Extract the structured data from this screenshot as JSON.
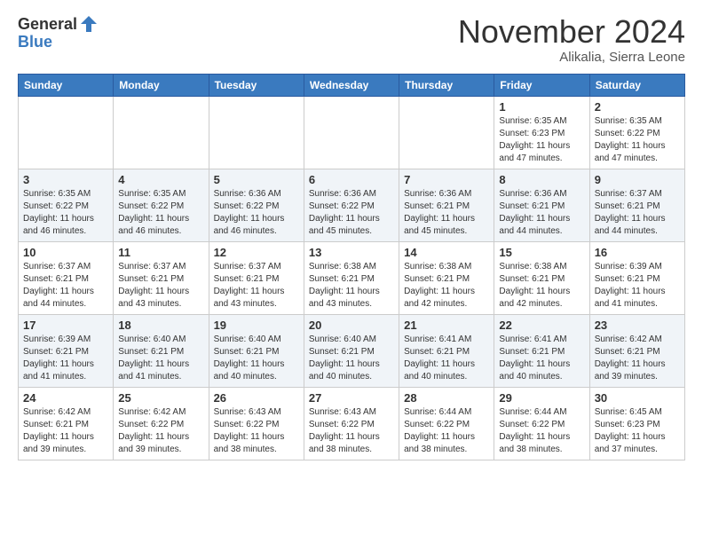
{
  "header": {
    "logo_general": "General",
    "logo_blue": "Blue",
    "month_title": "November 2024",
    "location": "Alikalia, Sierra Leone"
  },
  "weekdays": [
    "Sunday",
    "Monday",
    "Tuesday",
    "Wednesday",
    "Thursday",
    "Friday",
    "Saturday"
  ],
  "weeks": [
    [
      {
        "day": "",
        "info": ""
      },
      {
        "day": "",
        "info": ""
      },
      {
        "day": "",
        "info": ""
      },
      {
        "day": "",
        "info": ""
      },
      {
        "day": "",
        "info": ""
      },
      {
        "day": "1",
        "info": "Sunrise: 6:35 AM\nSunset: 6:23 PM\nDaylight: 11 hours and 47 minutes."
      },
      {
        "day": "2",
        "info": "Sunrise: 6:35 AM\nSunset: 6:22 PM\nDaylight: 11 hours and 47 minutes."
      }
    ],
    [
      {
        "day": "3",
        "info": "Sunrise: 6:35 AM\nSunset: 6:22 PM\nDaylight: 11 hours and 46 minutes."
      },
      {
        "day": "4",
        "info": "Sunrise: 6:35 AM\nSunset: 6:22 PM\nDaylight: 11 hours and 46 minutes."
      },
      {
        "day": "5",
        "info": "Sunrise: 6:36 AM\nSunset: 6:22 PM\nDaylight: 11 hours and 46 minutes."
      },
      {
        "day": "6",
        "info": "Sunrise: 6:36 AM\nSunset: 6:22 PM\nDaylight: 11 hours and 45 minutes."
      },
      {
        "day": "7",
        "info": "Sunrise: 6:36 AM\nSunset: 6:21 PM\nDaylight: 11 hours and 45 minutes."
      },
      {
        "day": "8",
        "info": "Sunrise: 6:36 AM\nSunset: 6:21 PM\nDaylight: 11 hours and 44 minutes."
      },
      {
        "day": "9",
        "info": "Sunrise: 6:37 AM\nSunset: 6:21 PM\nDaylight: 11 hours and 44 minutes."
      }
    ],
    [
      {
        "day": "10",
        "info": "Sunrise: 6:37 AM\nSunset: 6:21 PM\nDaylight: 11 hours and 44 minutes."
      },
      {
        "day": "11",
        "info": "Sunrise: 6:37 AM\nSunset: 6:21 PM\nDaylight: 11 hours and 43 minutes."
      },
      {
        "day": "12",
        "info": "Sunrise: 6:37 AM\nSunset: 6:21 PM\nDaylight: 11 hours and 43 minutes."
      },
      {
        "day": "13",
        "info": "Sunrise: 6:38 AM\nSunset: 6:21 PM\nDaylight: 11 hours and 43 minutes."
      },
      {
        "day": "14",
        "info": "Sunrise: 6:38 AM\nSunset: 6:21 PM\nDaylight: 11 hours and 42 minutes."
      },
      {
        "day": "15",
        "info": "Sunrise: 6:38 AM\nSunset: 6:21 PM\nDaylight: 11 hours and 42 minutes."
      },
      {
        "day": "16",
        "info": "Sunrise: 6:39 AM\nSunset: 6:21 PM\nDaylight: 11 hours and 41 minutes."
      }
    ],
    [
      {
        "day": "17",
        "info": "Sunrise: 6:39 AM\nSunset: 6:21 PM\nDaylight: 11 hours and 41 minutes."
      },
      {
        "day": "18",
        "info": "Sunrise: 6:40 AM\nSunset: 6:21 PM\nDaylight: 11 hours and 41 minutes."
      },
      {
        "day": "19",
        "info": "Sunrise: 6:40 AM\nSunset: 6:21 PM\nDaylight: 11 hours and 40 minutes."
      },
      {
        "day": "20",
        "info": "Sunrise: 6:40 AM\nSunset: 6:21 PM\nDaylight: 11 hours and 40 minutes."
      },
      {
        "day": "21",
        "info": "Sunrise: 6:41 AM\nSunset: 6:21 PM\nDaylight: 11 hours and 40 minutes."
      },
      {
        "day": "22",
        "info": "Sunrise: 6:41 AM\nSunset: 6:21 PM\nDaylight: 11 hours and 40 minutes."
      },
      {
        "day": "23",
        "info": "Sunrise: 6:42 AM\nSunset: 6:21 PM\nDaylight: 11 hours and 39 minutes."
      }
    ],
    [
      {
        "day": "24",
        "info": "Sunrise: 6:42 AM\nSunset: 6:21 PM\nDaylight: 11 hours and 39 minutes."
      },
      {
        "day": "25",
        "info": "Sunrise: 6:42 AM\nSunset: 6:22 PM\nDaylight: 11 hours and 39 minutes."
      },
      {
        "day": "26",
        "info": "Sunrise: 6:43 AM\nSunset: 6:22 PM\nDaylight: 11 hours and 38 minutes."
      },
      {
        "day": "27",
        "info": "Sunrise: 6:43 AM\nSunset: 6:22 PM\nDaylight: 11 hours and 38 minutes."
      },
      {
        "day": "28",
        "info": "Sunrise: 6:44 AM\nSunset: 6:22 PM\nDaylight: 11 hours and 38 minutes."
      },
      {
        "day": "29",
        "info": "Sunrise: 6:44 AM\nSunset: 6:22 PM\nDaylight: 11 hours and 38 minutes."
      },
      {
        "day": "30",
        "info": "Sunrise: 6:45 AM\nSunset: 6:23 PM\nDaylight: 11 hours and 37 minutes."
      }
    ]
  ]
}
